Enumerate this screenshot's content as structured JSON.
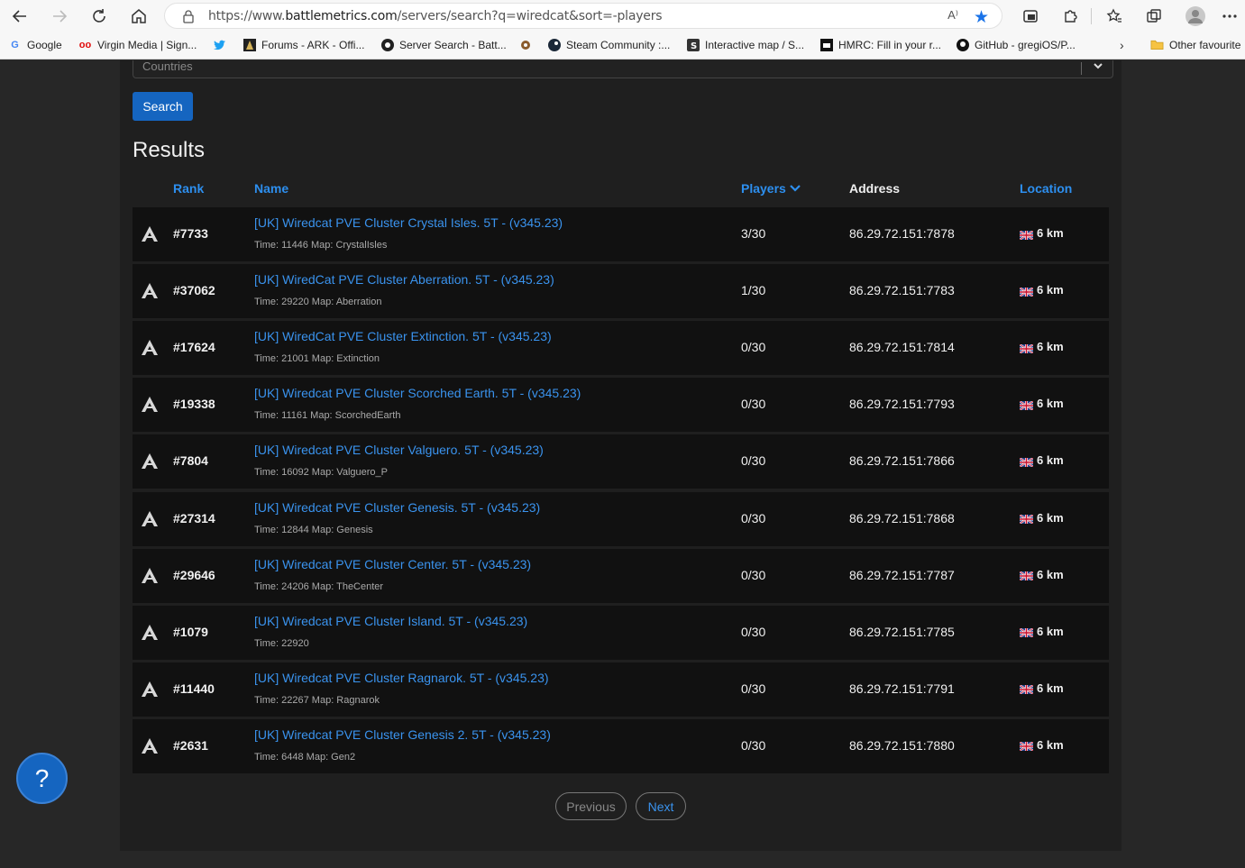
{
  "browser": {
    "url_prefix": "https://www.",
    "url_domain": "battlemetrics.com",
    "url_path": "/servers/search?q=wiredcat&sort=-players",
    "read_aloud": "A⁾",
    "bookmarks": [
      {
        "label": "Google",
        "icon": "google-icon"
      },
      {
        "label": "Virgin Media | Sign...",
        "icon": "virgin-icon"
      },
      {
        "label": "",
        "icon": "twitter-icon"
      },
      {
        "label": "Forums - ARK - Offi...",
        "icon": "ark-icon"
      },
      {
        "label": "Server Search - Batt...",
        "icon": "battlemetrics-icon"
      },
      {
        "label": "",
        "icon": "gear-icon"
      },
      {
        "label": "Steam Community :...",
        "icon": "steam-icon"
      },
      {
        "label": "Interactive map / S...",
        "icon": "map-icon"
      },
      {
        "label": "HMRC: Fill in your r...",
        "icon": "hmrc-icon"
      },
      {
        "label": "GitHub - gregiOS/P...",
        "icon": "github-icon"
      }
    ],
    "other_favourites": "Other favourite"
  },
  "filters": {
    "countries_placeholder": "Countries",
    "search_label": "Search"
  },
  "results": {
    "title": "Results",
    "columns": {
      "rank": "Rank",
      "name": "Name",
      "players": "Players",
      "address": "Address",
      "location": "Location"
    },
    "rows": [
      {
        "rank": "#7733",
        "name": "[UK] Wiredcat PVE Cluster Crystal Isles. 5T - (v345.23)",
        "meta": "Time: 11446  Map: CrystalIsles",
        "players": "3/30",
        "address": "86.29.72.151:7878",
        "location": "6 km"
      },
      {
        "rank": "#37062",
        "name": "[UK] WiredCat PVE Cluster Aberration. 5T - (v345.23)",
        "meta": "Time: 29220  Map: Aberration",
        "players": "1/30",
        "address": "86.29.72.151:7783",
        "location": "6 km"
      },
      {
        "rank": "#17624",
        "name": "[UK] WiredCat PVE Cluster Extinction. 5T - (v345.23)",
        "meta": "Time: 21001  Map: Extinction",
        "players": "0/30",
        "address": "86.29.72.151:7814",
        "location": "6 km"
      },
      {
        "rank": "#19338",
        "name": "[UK] Wiredcat PVE Cluster Scorched Earth. 5T - (v345.23)",
        "meta": "Time: 11161  Map: ScorchedEarth",
        "players": "0/30",
        "address": "86.29.72.151:7793",
        "location": "6 km"
      },
      {
        "rank": "#7804",
        "name": "[UK] Wiredcat PVE Cluster Valguero. 5T - (v345.23)",
        "meta": "Time: 16092  Map: Valguero_P",
        "players": "0/30",
        "address": "86.29.72.151:7866",
        "location": "6 km"
      },
      {
        "rank": "#27314",
        "name": "[UK] Wiredcat PVE Cluster Genesis. 5T - (v345.23)",
        "meta": "Time: 12844  Map: Genesis",
        "players": "0/30",
        "address": "86.29.72.151:7868",
        "location": "6 km"
      },
      {
        "rank": "#29646",
        "name": "[UK] Wiredcat PVE Cluster Center. 5T - (v345.23)",
        "meta": "Time: 24206  Map: TheCenter",
        "players": "0/30",
        "address": "86.29.72.151:7787",
        "location": "6 km"
      },
      {
        "rank": "#1079",
        "name": "[UK] Wiredcat PVE Cluster Island. 5T - (v345.23)",
        "meta": "Time: 22920",
        "players": "0/30",
        "address": "86.29.72.151:7785",
        "location": "6 km"
      },
      {
        "rank": "#11440",
        "name": "[UK] Wiredcat PVE Cluster Ragnarok. 5T - (v345.23)",
        "meta": "Time: 22267  Map: Ragnarok",
        "players": "0/30",
        "address": "86.29.72.151:7791",
        "location": "6 km"
      },
      {
        "rank": "#2631",
        "name": "[UK] Wiredcat PVE Cluster Genesis 2. 5T - (v345.23)",
        "meta": "Time: 6448  Map: Gen2",
        "players": "0/30",
        "address": "86.29.72.151:7880",
        "location": "6 km"
      }
    ]
  },
  "pagination": {
    "previous": "Previous",
    "next": "Next"
  },
  "help": "?",
  "colors": {
    "accent": "#1565c0",
    "link": "#3a93ee",
    "row_bg": "#111111",
    "page_bg": "#1f1f1f"
  }
}
